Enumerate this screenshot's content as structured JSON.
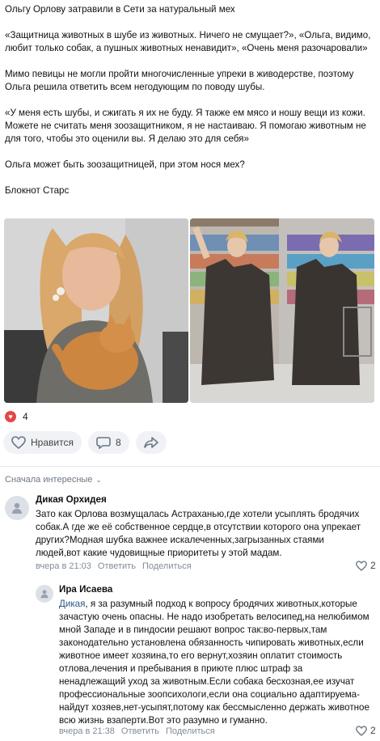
{
  "post": {
    "paragraphs": [
      "Ольгу Орлову затравили в Сети за натуральный мех",
      "«Защитница животных в шубе из животных. Ничего не смущает?», «Ольга, видимо, любит только собак, а пушных животных ненавидит», «Очень меня разочаровали»",
      "Мимо певицы не могли пройти многочисленные упреки в живодерстве, поэтому Ольга решила ответить всем негодующим по поводу шубы.",
      "«У меня есть шубы, и сжигать я их не буду. Я также ем мясо и ношу вещи из кожи. Можете не считать меня зоозащитником, я не настаиваю. Я помогаю животным не для того, чтобы это оценили вы. Я делаю это для себя»",
      "Ольга может быть зоозащитницей, при этом нося мех?",
      "Блокнот Старс"
    ],
    "likes_count": "4",
    "like_label": "Нравится",
    "comments_count": "8"
  },
  "comments_sort": "Сначала интересные",
  "comments": [
    {
      "author": "Дикая Орхидея",
      "text": "Зато как Орлова возмущалась Астраханью,где хотели усыплять бродячих собак.А где же её собственное сердце,в отсутствии которого она упрекает других?Модная шубка важнее искалеченных,загрызанных стаями людей,вот какие чудовищные приоритеты у этой мадам.",
      "time": "вчера в 21:03",
      "reply": "Ответить",
      "share": "Поделиться",
      "likes": "2"
    },
    {
      "author": "Ира Исаева",
      "mention": "Дикая",
      "text": ", я за разумный подход к вопросу бродячих животных,которые зачастую очень опасны. Не надо изобретать велосипед,на нелюбимом мной Западе и в пиндосии решают вопрос так:во-первых,там законодательно установлена обязанность чипировать животных,если животное имеет хозяина,то его вернут,хозяин оплатит стоимость отлова,лечения и пребывания в приюте плюс штраф за ненадлежащий уход за животным.Если собака бесхозная,ее изучат профессиональные зоопсихологи,если она социально адаптируема-найдут хозяев,нет-усыпят,потому как бессмысленно держать животное всю жизнь взаперти.Вот это разумно и гуманно.",
      "time": "вчера в 21:38",
      "reply": "Ответить",
      "share": "Поделиться",
      "likes": "2"
    }
  ],
  "colors": {
    "accent_red": "#e64646",
    "link": "#2a5885",
    "meta": "#818c99",
    "pill_bg": "#f0f2f5"
  },
  "icons": [
    "heart-icon",
    "comment-icon",
    "share-icon",
    "user-icon",
    "like-outline-icon",
    "chevron-down-icon"
  ]
}
